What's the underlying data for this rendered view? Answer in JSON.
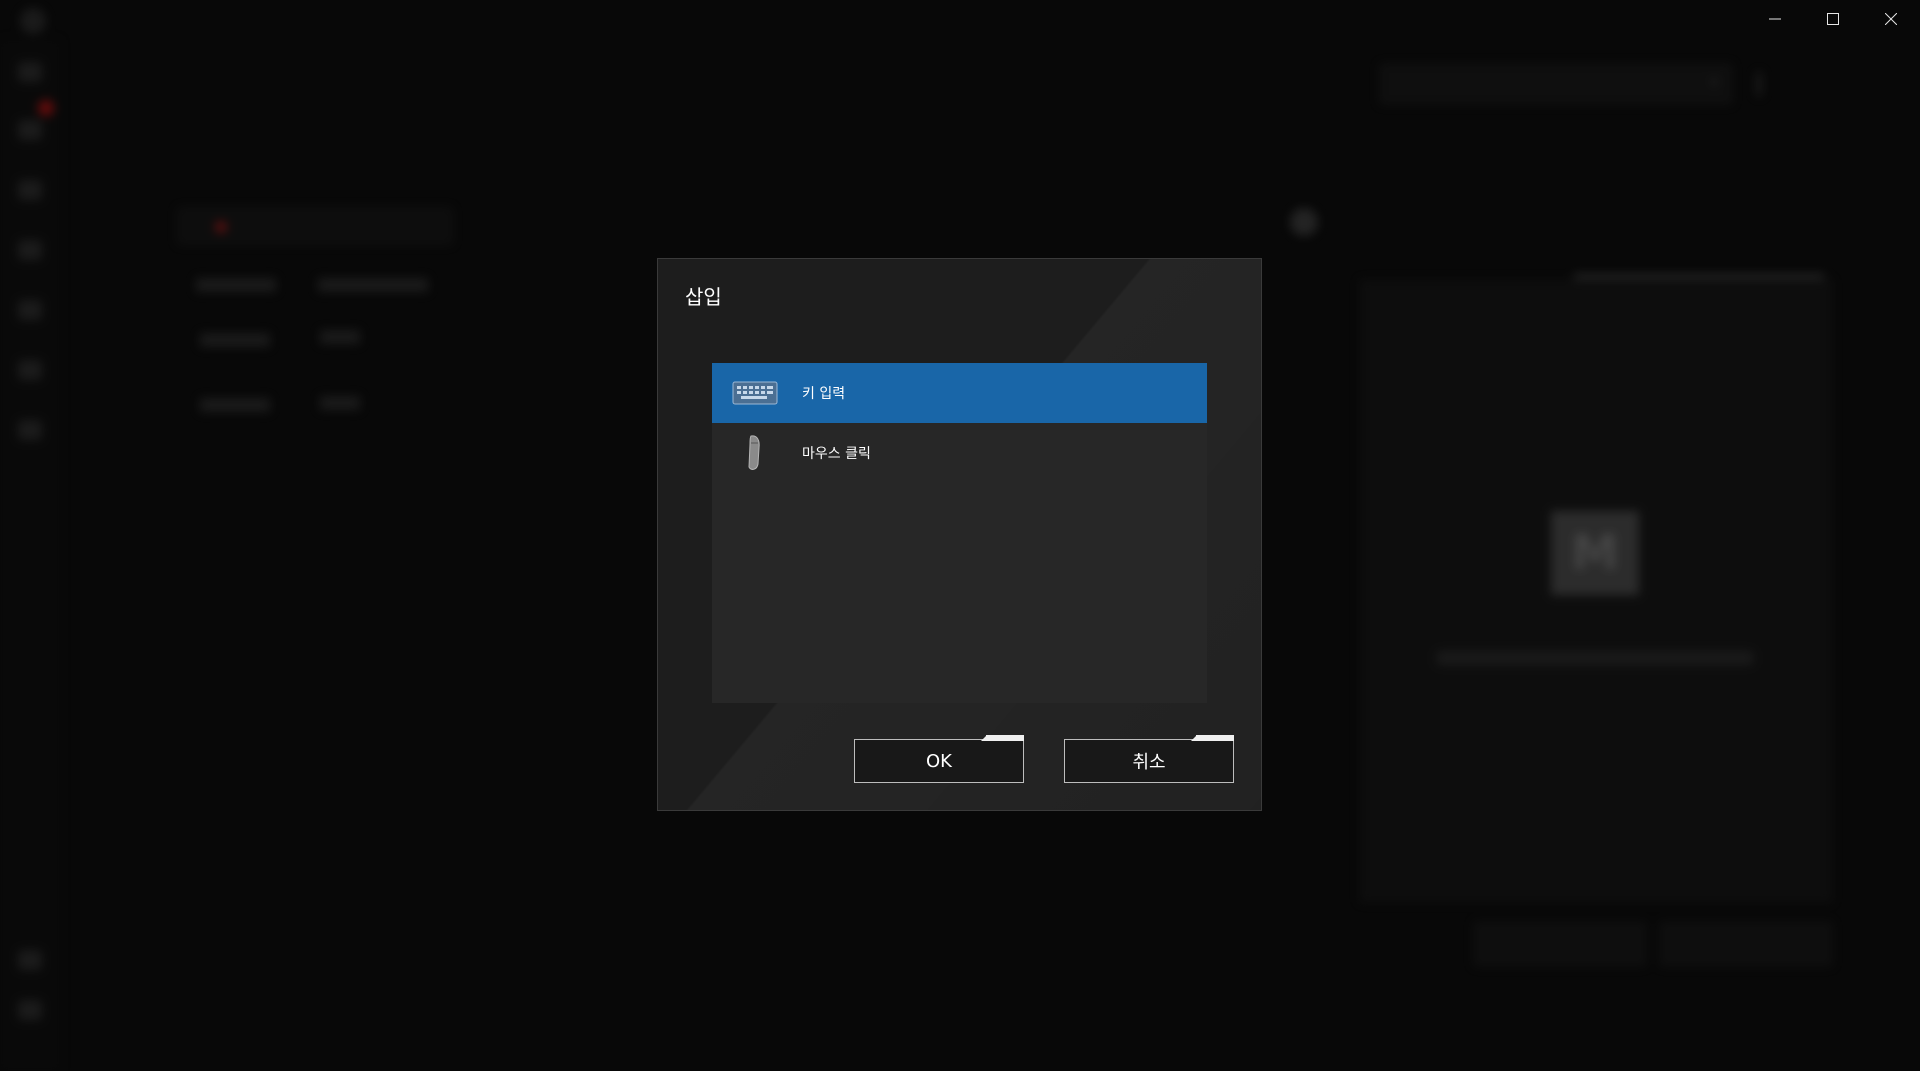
{
  "window": {
    "minimize_symbol": "—",
    "maximize_symbol": "☐",
    "close_symbol": "✕"
  },
  "dialog": {
    "title": "삽입",
    "items": [
      {
        "label": "키 입력",
        "icon": "keyboard-icon",
        "selected": true
      },
      {
        "label": "마우스 클릭",
        "icon": "mouse-icon",
        "selected": false
      }
    ],
    "ok_label": "OK",
    "cancel_label": "취소"
  },
  "colors": {
    "selection": "#1966a8",
    "dialog_bg": "#1d1d1d",
    "list_bg": "#272727",
    "recording_red": "#b01010"
  }
}
